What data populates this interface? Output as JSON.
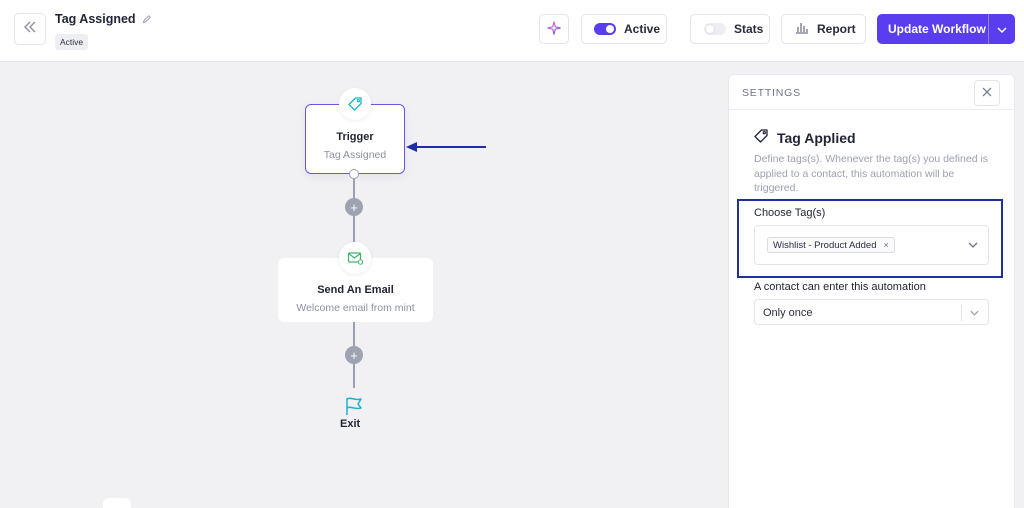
{
  "header": {
    "title": "Tag Assigned",
    "status_badge": "Active",
    "active_label": "Active",
    "stats_label": "Stats",
    "report_label": "Report",
    "update_label": "Update Workflow"
  },
  "canvas": {
    "trigger": {
      "title": "Trigger",
      "subtitle": "Tag Assigned"
    },
    "email": {
      "title": "Send An Email",
      "subtitle": "Welcome email from mint"
    },
    "exit": {
      "label": "Exit"
    },
    "plus_symbol": "+"
  },
  "settings": {
    "panel_title": "SETTINGS",
    "section_title": "Tag Applied",
    "description": "Define tags(s). Whenever the tag(s) you defined is applied to a contact, this automation will be triggered.",
    "choose_label": "Choose Tag(s)",
    "selected_tags": [
      "Wishlist - Product Added"
    ],
    "remove_symbol": "×",
    "entry_label": "A contact can enter this automation",
    "entry_value": "Only once"
  },
  "colors": {
    "accent": "#5b3df0",
    "highlight_box": "#1f2fa0",
    "arrow": "#1f2fa0",
    "teal_icon": "#19b6c9"
  },
  "icons": {
    "back": "double-chevron-left-icon",
    "edit": "pencil-icon",
    "ai": "sparkle-icon",
    "report": "bar-chart-icon",
    "dropdown": "chevron-down-icon",
    "close": "close-icon",
    "trigger": "tag-icon",
    "email": "envelope-icon",
    "exit": "flag-icon"
  }
}
